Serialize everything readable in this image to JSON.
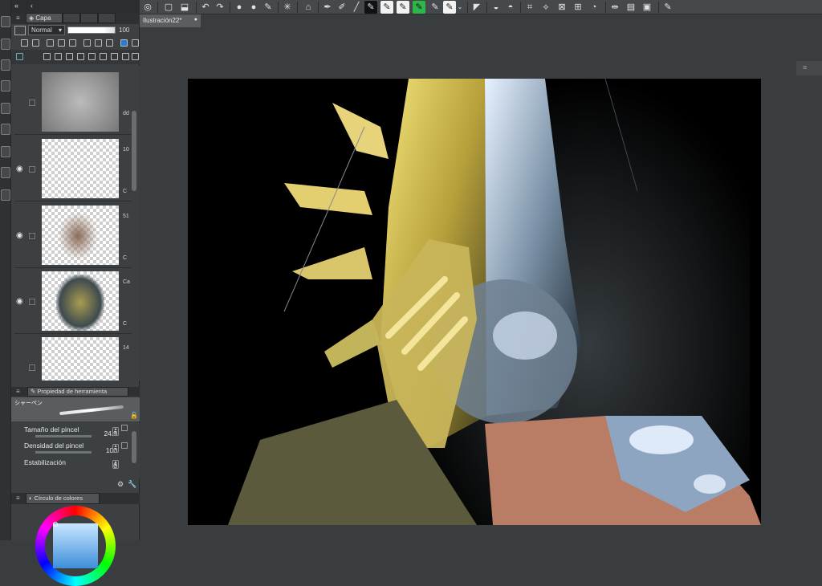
{
  "layer_panel": {
    "tab_label": "Capa",
    "blend_mode": "Normal",
    "opacity": "100",
    "layers": [
      {
        "name": "dd",
        "visible": false
      },
      {
        "name": "10",
        "visible": true
      },
      {
        "name": "51",
        "visible": true
      },
      {
        "name": "Ca",
        "visible": true
      },
      {
        "name": "14",
        "visible": false
      }
    ],
    "layer_letters": [
      "C",
      "C",
      "C"
    ]
  },
  "tool_property": {
    "title": "Propiedad de herramienta",
    "brush_name": "シャーペン",
    "brush_size_label": "Tamaño del pincel",
    "brush_size_value": "24.9",
    "density_label": "Densidad del pincel",
    "density_value": "100",
    "stabilization_label": "Estabilización",
    "stabilization_value": "0"
  },
  "color_panel": {
    "title": "Círculo de colores"
  },
  "document": {
    "tab_title": "Ilustración22*"
  },
  "colors": {
    "panel_bg": "#3c4042",
    "toolbar_bg": "#45494c",
    "canvas_bg": "#000000",
    "workspace_bg": "#3a3d3f",
    "accent_green": "#2fb64a"
  }
}
